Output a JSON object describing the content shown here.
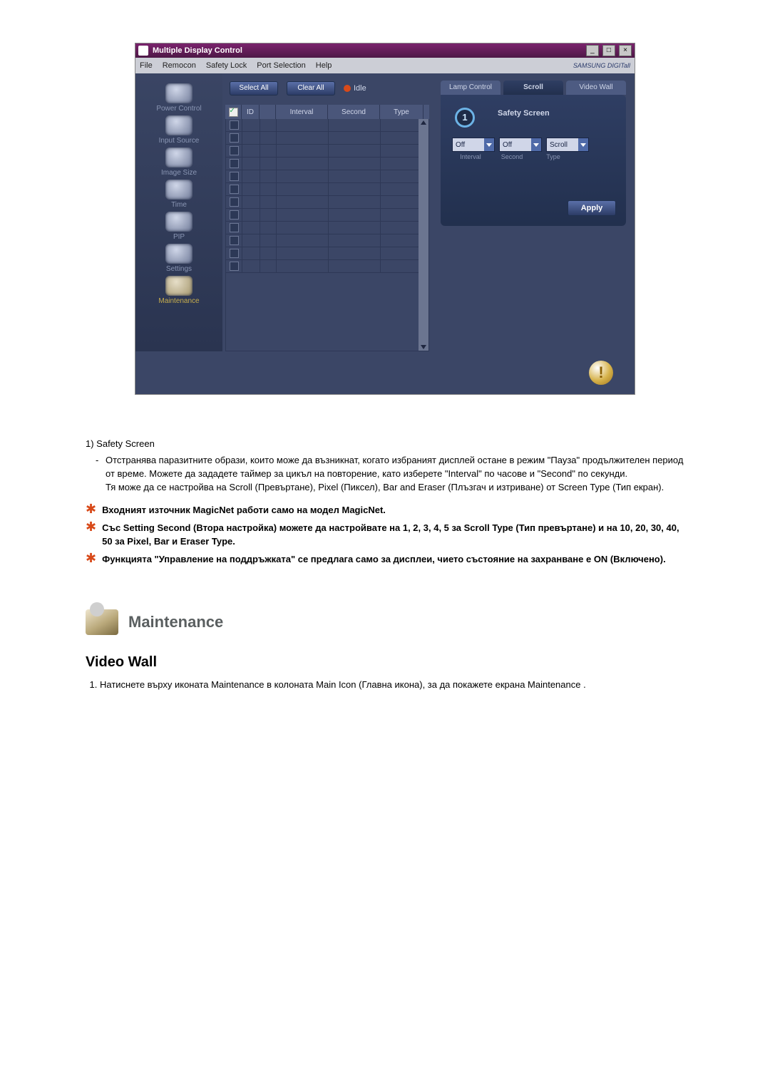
{
  "screenshot": {
    "title": "Multiple Display Control",
    "menus": [
      "File",
      "Remocon",
      "Safety Lock",
      "Port Selection",
      "Help"
    ],
    "brand": "SAMSUNG DIGITall",
    "sidebar": [
      {
        "label": "Power Control"
      },
      {
        "label": "Input Source"
      },
      {
        "label": "Image Size"
      },
      {
        "label": "Time"
      },
      {
        "label": "PIP"
      },
      {
        "label": "Settings"
      },
      {
        "label": "Maintenance"
      }
    ],
    "toolbar": {
      "select_all": "Select All",
      "clear_all": "Clear All",
      "idle": "Idle"
    },
    "grid_headers": {
      "id": "ID",
      "interval": "Interval",
      "second": "Second",
      "type": "Type"
    },
    "right": {
      "tabs": [
        "Lamp Control",
        "Scroll",
        "Video Wall"
      ],
      "panel_title": "Safety Screen",
      "callout_num": "1",
      "dd": {
        "interval": "Off",
        "second": "Off",
        "type": "Scroll"
      },
      "dd_labels": {
        "interval": "Interval",
        "second": "Second",
        "type": "Type"
      },
      "apply": "Apply"
    }
  },
  "doc": {
    "item1_label": "Safety Screen",
    "item1_body": "Отстранява паразитните образи, които може да възникнат, когато избраният дисплей остане в режим \"Пауза\" продължителен период от време. Можете да зададете таймер за цикъл на повторение, като изберете \"Interval\" по часове и \"Second\" по секунди.\nТя може да се настройва на Scroll (Превъртане), Pixel (Пиксел), Bar and Eraser (Плъзгач и изтриване) от Screen Type (Тип екран).",
    "note1": "Входният източник MagicNet работи само на модел MagicNet.",
    "note2": "Със Setting Second (Втора настройка) можете да настройвате на 1, 2, 3, 4, 5 за Scroll Type (Тип превъртане) и на 10, 20, 30, 40, 50 за Pixel, Bar и Eraser Type.",
    "note3": "Функцията \"Управление на поддръжката\" се предлага само за дисплеи, чието състояние на захранване е ON (Включено).",
    "section_title": "Maintenance",
    "subheading": "Video Wall",
    "step1": "Натиснете върху иконата Maintenance в колоната Main Icon (Главна икона), за да покажете екрана Maintenance ."
  }
}
